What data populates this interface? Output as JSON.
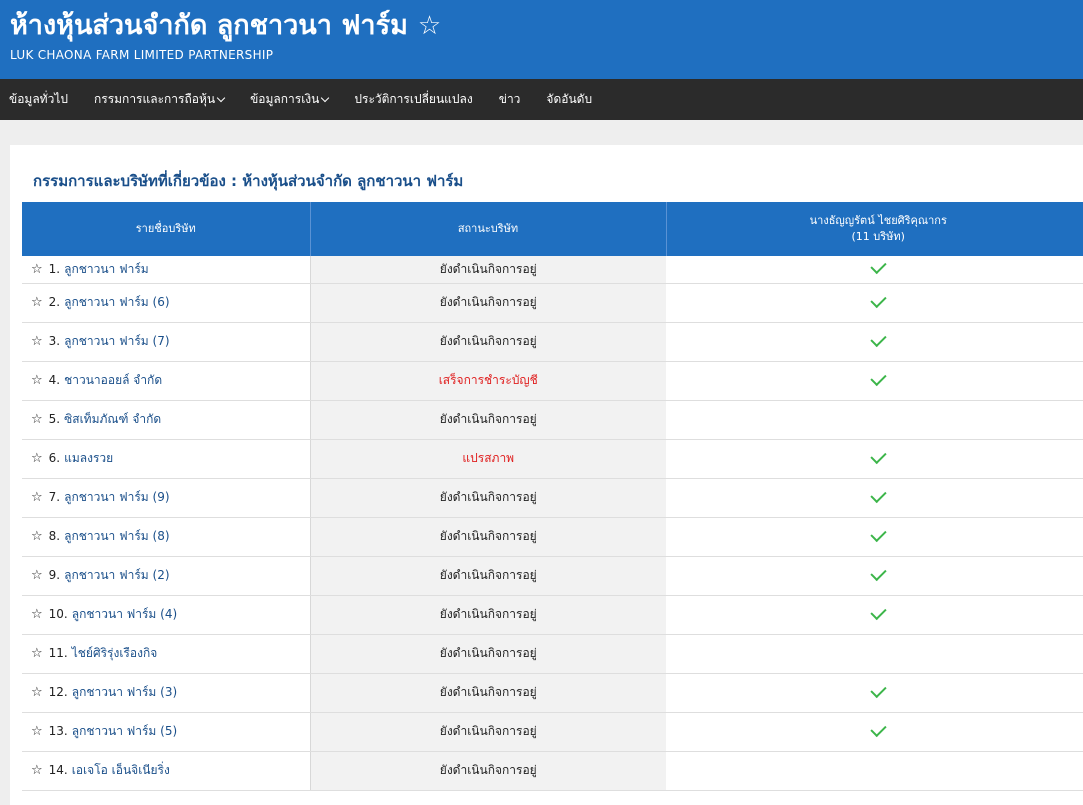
{
  "header": {
    "title": "ห้างหุ้นส่วนจำกัด ลูกชาวนา ฟาร์ม",
    "subtitle": "LUK CHAONA FARM LIMITED PARTNERSHIP",
    "star_icon": "star-outline-icon"
  },
  "nav": {
    "items": [
      {
        "label": "ข้อมูลทั่วไป",
        "has_dropdown": false
      },
      {
        "label": "กรรมการและการถือหุ้น",
        "has_dropdown": true
      },
      {
        "label": "ข้อมูลการเงิน",
        "has_dropdown": true
      },
      {
        "label": "ประวัติการเปลี่ยนแปลง",
        "has_dropdown": false
      },
      {
        "label": "ข่าว",
        "has_dropdown": false
      },
      {
        "label": "จัดอันดับ",
        "has_dropdown": false
      }
    ]
  },
  "section": {
    "title": "กรรมการและบริษัทที่เกี่ยวข้อง : ห้างหุ้นส่วนจำกัด ลูกชาวนา ฟาร์ม"
  },
  "table": {
    "headers": {
      "name": "รายชื่อบริษัท",
      "status": "สถานะบริษัท",
      "person": "นางธัญญรัตน์ ไชยศิริคุณากร",
      "person_count": "(11 บริษัท)"
    },
    "rows": [
      {
        "num": "1.",
        "name": "ลูกชาวนา ฟาร์ม",
        "status": "ยังดำเนินกิจการอยู่",
        "status_color": "#222222",
        "checked": true
      },
      {
        "num": "2.",
        "name": "ลูกชาวนา ฟาร์ม (6)",
        "status": "ยังดำเนินกิจการอยู่",
        "status_color": "#222222",
        "checked": true
      },
      {
        "num": "3.",
        "name": "ลูกชาวนา ฟาร์ม (7)",
        "status": "ยังดำเนินกิจการอยู่",
        "status_color": "#222222",
        "checked": true
      },
      {
        "num": "4.",
        "name": "ชาวนาออยล์ จำกัด",
        "status": "เสร็จการชำระบัญชี",
        "status_color": "#e02020",
        "checked": true
      },
      {
        "num": "5.",
        "name": "ซิสเท็มภัณฑ์ จำกัด",
        "status": "ยังดำเนินกิจการอยู่",
        "status_color": "#222222",
        "checked": false
      },
      {
        "num": "6.",
        "name": "แมลงรวย",
        "status": "แปรสภาพ",
        "status_color": "#e02020",
        "checked": true
      },
      {
        "num": "7.",
        "name": "ลูกชาวนา ฟาร์ม (9)",
        "status": "ยังดำเนินกิจการอยู่",
        "status_color": "#222222",
        "checked": true
      },
      {
        "num": "8.",
        "name": "ลูกชาวนา ฟาร์ม (8)",
        "status": "ยังดำเนินกิจการอยู่",
        "status_color": "#222222",
        "checked": true
      },
      {
        "num": "9.",
        "name": "ลูกชาวนา ฟาร์ม (2)",
        "status": "ยังดำเนินกิจการอยู่",
        "status_color": "#222222",
        "checked": true
      },
      {
        "num": "10.",
        "name": "ลูกชาวนา ฟาร์ม (4)",
        "status": "ยังดำเนินกิจการอยู่",
        "status_color": "#222222",
        "checked": true
      },
      {
        "num": "11.",
        "name": "ไชย์ศิริรุ่งเรืองกิจ",
        "status": "ยังดำเนินกิจการอยู่",
        "status_color": "#222222",
        "checked": false
      },
      {
        "num": "12.",
        "name": "ลูกชาวนา ฟาร์ม (3)",
        "status": "ยังดำเนินกิจการอยู่",
        "status_color": "#222222",
        "checked": true
      },
      {
        "num": "13.",
        "name": "ลูกชาวนา ฟาร์ม (5)",
        "status": "ยังดำเนินกิจการอยู่",
        "status_color": "#222222",
        "checked": true
      },
      {
        "num": "14.",
        "name": "เอเจโอ เอ็นจิเนียริ่ง",
        "status": "ยังดำเนินกิจการอยู่",
        "status_color": "#222222",
        "checked": false
      }
    ]
  },
  "colors": {
    "brand_blue": "#1f6fc0",
    "nav_bg": "#2b2b2b",
    "link_blue": "#1a4f8a",
    "status_red": "#e02020",
    "check_green": "#3cb54a"
  }
}
